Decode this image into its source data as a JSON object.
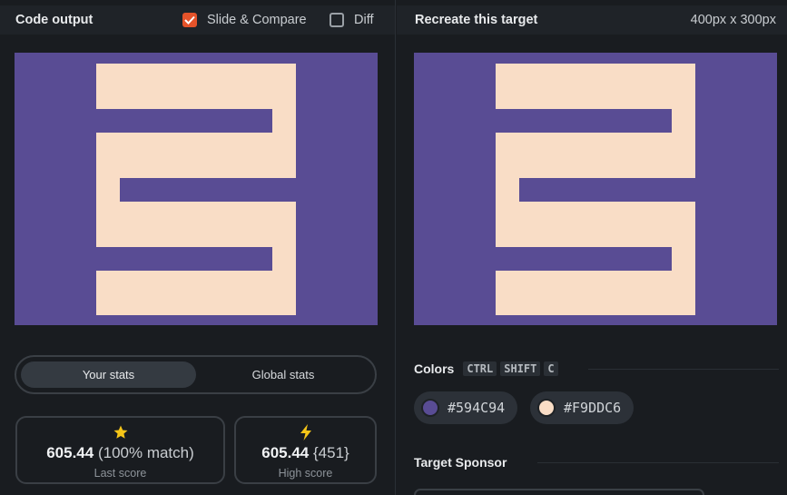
{
  "left": {
    "title": "Code output",
    "slide_compare": {
      "label": "Slide & Compare",
      "checked": true
    },
    "diff": {
      "label": "Diff",
      "checked": false
    }
  },
  "right": {
    "title": "Recreate this target",
    "dimensions": "400px x 300px"
  },
  "stats_toggle": {
    "active": "Your stats",
    "inactive": "Global stats"
  },
  "last_score": {
    "icon": "star-icon",
    "value": "605.44",
    "detail": "(100% match)",
    "label": "Last score"
  },
  "high_score": {
    "icon": "lightning-icon",
    "value": "605.44",
    "detail": "{451}",
    "label": "High score"
  },
  "colors_section": {
    "title": "Colors",
    "shortcut": [
      "CTRL",
      "SHIFT",
      "C"
    ],
    "swatches": [
      {
        "hex": "#594C94",
        "label": "#594C94"
      },
      {
        "hex": "#F9DDC6",
        "label": "#F9DDC6"
      }
    ]
  },
  "sponsor_section": {
    "title": "Target Sponsor"
  },
  "palette": {
    "accent": "#e5532a",
    "background": "#594C94",
    "foreground": "#F9DDC6"
  }
}
